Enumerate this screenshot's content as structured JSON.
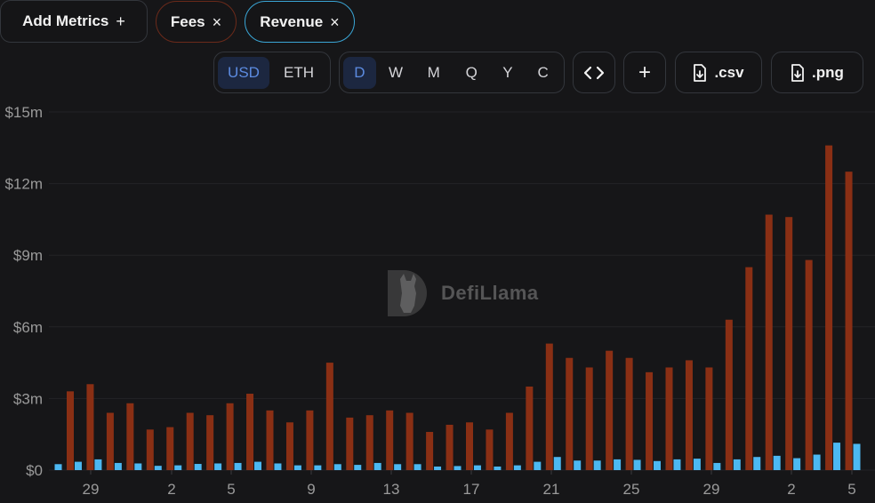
{
  "metrics": {
    "add_label": "Add Metrics",
    "add_glyph": "+",
    "pills": [
      {
        "label": "Fees",
        "close": "×"
      },
      {
        "label": "Revenue",
        "close": "×"
      }
    ]
  },
  "currency": {
    "options": [
      "USD",
      "ETH"
    ],
    "selected": "USD"
  },
  "period": {
    "options": [
      "D",
      "W",
      "M",
      "Q",
      "Y",
      "C"
    ],
    "selected": "D"
  },
  "actions": {
    "embed_icon": "code-brackets-icon",
    "add_glyph": "+",
    "csv_label": ".csv",
    "png_label": ".png"
  },
  "watermark": {
    "text": "DefiLlama"
  },
  "colors": {
    "fees": "#8a2f14",
    "revenue": "#4cb8f2",
    "grid": "#232326",
    "axis_text": "#9a9a9a"
  },
  "chart_data": {
    "type": "bar",
    "ylim": [
      0,
      15
    ],
    "y_ticks": [
      "$0",
      "$3m",
      "$6m",
      "$9m",
      "$12m",
      "$15m"
    ],
    "x_tick_labels": [
      "29",
      "2",
      "5",
      "9",
      "13",
      "17",
      "21",
      "25",
      "29",
      "2",
      "5"
    ],
    "grid": true,
    "unit": "USD millions",
    "series": [
      {
        "name": "Fees",
        "values": [
          3.3,
          3.6,
          2.4,
          2.8,
          1.7,
          1.8,
          2.4,
          2.3,
          2.8,
          3.2,
          2.5,
          2.0,
          2.5,
          4.5,
          2.2,
          2.3,
          2.5,
          2.4,
          1.6,
          1.9,
          2.0,
          1.7,
          2.4,
          3.5,
          5.3,
          4.7,
          4.3,
          5.0,
          4.7,
          4.1,
          4.3,
          4.6,
          4.3,
          6.3,
          8.5,
          10.7,
          10.6,
          8.8,
          13.6,
          12.5
        ]
      },
      {
        "name": "Revenue",
        "values": [
          0.25,
          0.35,
          0.45,
          0.3,
          0.28,
          0.18,
          0.2,
          0.26,
          0.28,
          0.3,
          0.35,
          0.28,
          0.2,
          0.2,
          0.25,
          0.22,
          0.3,
          0.25,
          0.25,
          0.15,
          0.17,
          0.2,
          0.15,
          0.2,
          0.35,
          0.55,
          0.4,
          0.4,
          0.45,
          0.43,
          0.38,
          0.45,
          0.48,
          0.3,
          0.45,
          0.55,
          0.6,
          0.5,
          0.65,
          1.15,
          1.1
        ]
      }
    ]
  }
}
